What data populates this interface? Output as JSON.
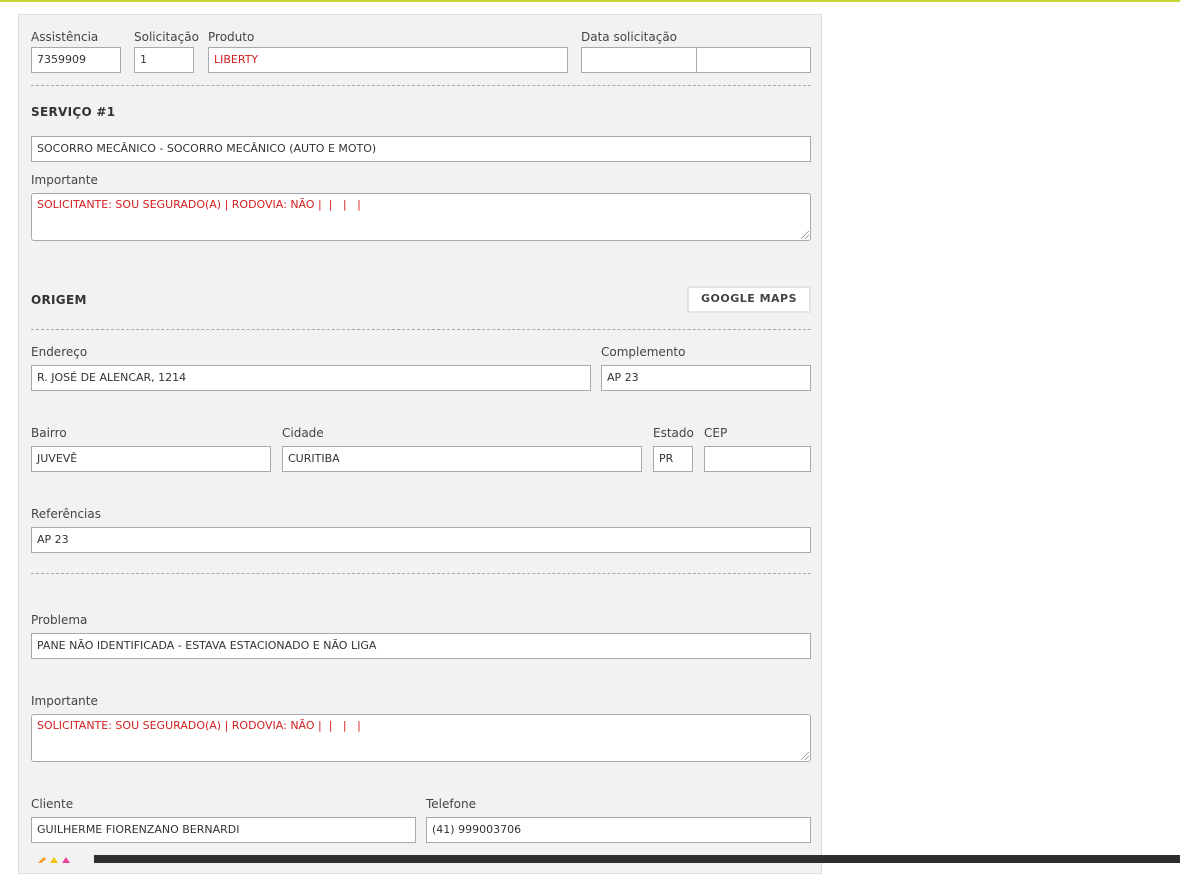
{
  "header": {
    "assistencia_label": "Assistência",
    "assistencia_value": "7359909",
    "solicitacao_label": "Solicitação",
    "solicitacao_value": "1",
    "produto_label": "Produto",
    "produto_value": "LIBERTY",
    "data_label": "Data solicitação",
    "data_value_1": "",
    "data_value_2": ""
  },
  "servico": {
    "title": "SERVIÇO #1",
    "value": "SOCORRO MECÂNICO - SOCORRO MECÂNICO (AUTO E MOTO)",
    "importante_label": "Importante",
    "importante_value": "SOLICITANTE: SOU SEGURADO(A) | RODOVIA: NÃO |  |   |   |"
  },
  "origem": {
    "title": "ORIGEM",
    "maps_button": "GOOGLE MAPS",
    "endereco_label": "Endereço",
    "endereco_value": "R. JOSÉ DE ALENCAR, 1214",
    "complemento_label": "Complemento",
    "complemento_value": "AP 23",
    "bairro_label": "Bairro",
    "bairro_value": "JUVEVÊ",
    "cidade_label": "Cidade",
    "cidade_value": "CURITIBA",
    "estado_label": "Estado",
    "estado_value": "PR",
    "cep_label": "CEP",
    "cep_value": "",
    "referencias_label": "Referências",
    "referencias_value": "AP 23"
  },
  "problema": {
    "label": "Problema",
    "value": "PANE NÃO IDENTIFICADA - ESTAVA ESTACIONADO E NÃO LIGA",
    "importante_label": "Importante",
    "importante_value": "SOLICITANTE: SOU SEGURADO(A) | RODOVIA: NÃO |  |   |   |"
  },
  "cliente": {
    "cliente_label": "Cliente",
    "cliente_value": "GUILHERME FIORENZANO BERNARDI",
    "telefone_label": "Telefone",
    "telefone_value": "(41) 999003706"
  },
  "colors": {
    "accent_line": "#c9d634",
    "alert_text": "#d21e1e"
  }
}
